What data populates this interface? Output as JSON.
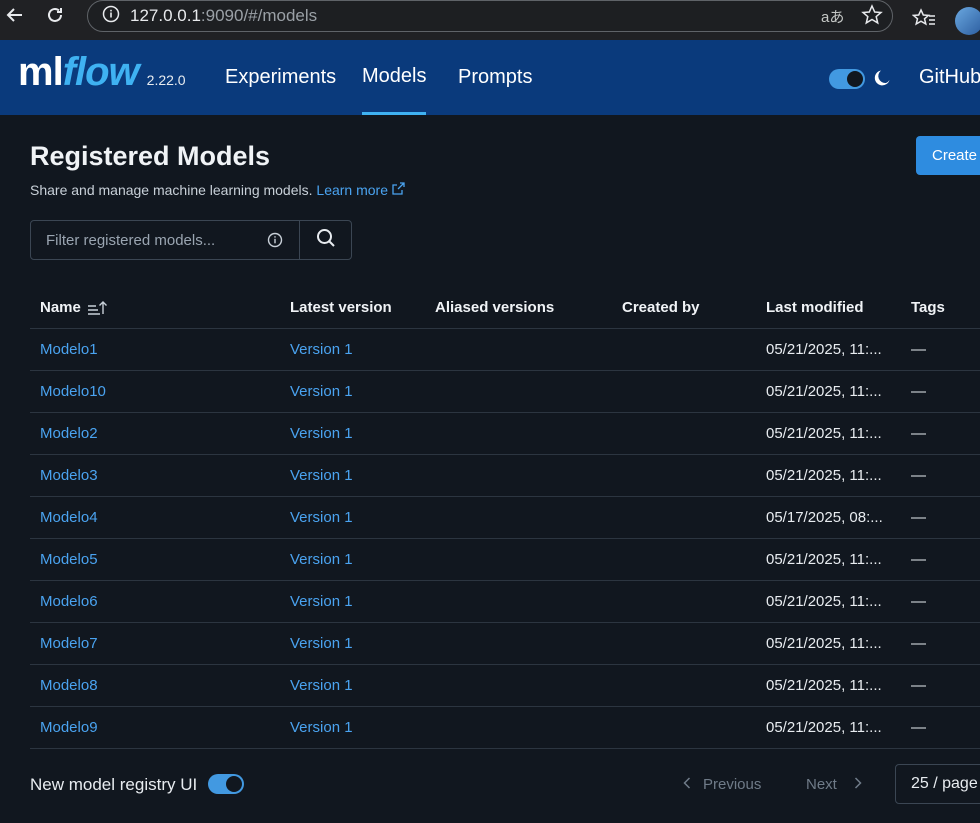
{
  "browser": {
    "url_host": "127.0.0.1",
    "url_rest": ":9090/#/models"
  },
  "app": {
    "logo_ml": "ml",
    "logo_flow": "flow",
    "version": "2.22.0",
    "nav": [
      {
        "label": "Experiments"
      },
      {
        "label": "Models"
      },
      {
        "label": "Prompts"
      }
    ],
    "github_label": "GitHub"
  },
  "page": {
    "title": "Registered Models",
    "subtitle": "Share and manage machine learning models.",
    "learn_more": "Learn more",
    "create_button": "Create",
    "search_placeholder": "Filter registered models..."
  },
  "table": {
    "headers": {
      "name": "Name",
      "latest_version": "Latest version",
      "aliased_versions": "Aliased versions",
      "created_by": "Created by",
      "last_modified": "Last modified",
      "tags": "Tags"
    },
    "rows": [
      {
        "name": "Modelo1",
        "version": "Version 1",
        "modified": "05/21/2025, 11:...",
        "tags": "—"
      },
      {
        "name": "Modelo10",
        "version": "Version 1",
        "modified": "05/21/2025, 11:...",
        "tags": "—"
      },
      {
        "name": "Modelo2",
        "version": "Version 1",
        "modified": "05/21/2025, 11:...",
        "tags": "—"
      },
      {
        "name": "Modelo3",
        "version": "Version 1",
        "modified": "05/21/2025, 11:...",
        "tags": "—"
      },
      {
        "name": "Modelo4",
        "version": "Version 1",
        "modified": "05/17/2025, 08:...",
        "tags": "—"
      },
      {
        "name": "Modelo5",
        "version": "Version 1",
        "modified": "05/21/2025, 11:...",
        "tags": "—"
      },
      {
        "name": "Modelo6",
        "version": "Version 1",
        "modified": "05/21/2025, 11:...",
        "tags": "—"
      },
      {
        "name": "Modelo7",
        "version": "Version 1",
        "modified": "05/21/2025, 11:...",
        "tags": "—"
      },
      {
        "name": "Modelo8",
        "version": "Version 1",
        "modified": "05/21/2025, 11:...",
        "tags": "—"
      },
      {
        "name": "Modelo9",
        "version": "Version 1",
        "modified": "05/21/2025, 11:...",
        "tags": "—"
      }
    ]
  },
  "footer": {
    "registry_toggle_label": "New model registry UI",
    "previous": "Previous",
    "next": "Next",
    "page_size": "25 / page"
  },
  "colors": {
    "header_bg": "#0a3a7c",
    "accent": "#3fb2f2",
    "link": "#4aa3f0",
    "page_bg": "#11171f"
  }
}
